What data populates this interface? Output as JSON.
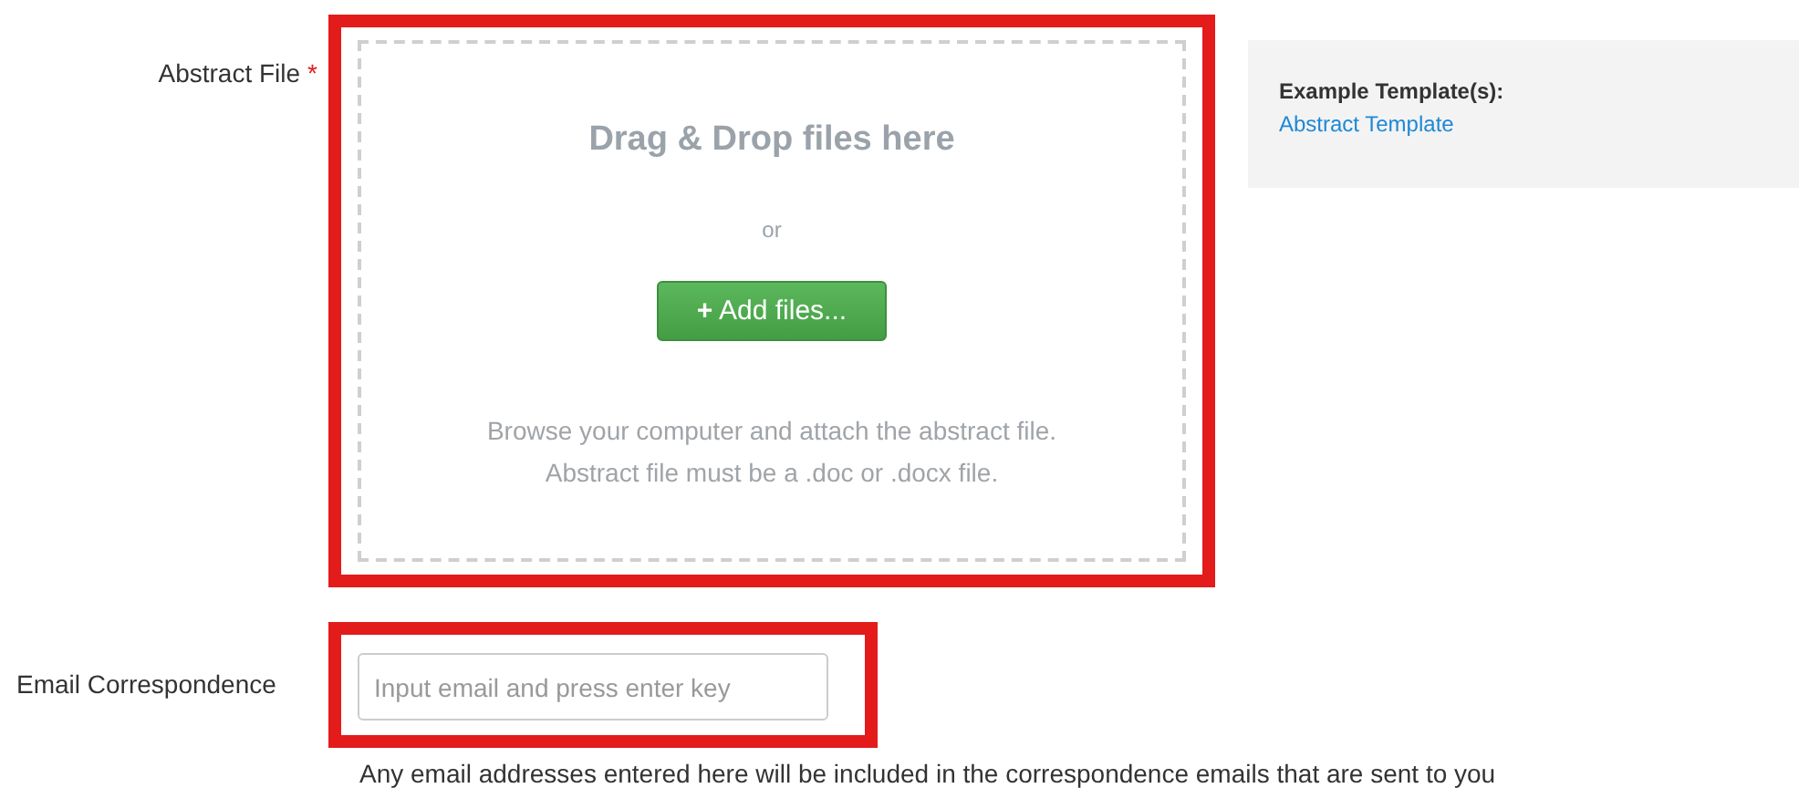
{
  "abstract_file": {
    "label": "Abstract File",
    "required_mark": "*",
    "highlighted": true,
    "dropzone": {
      "title": "Drag & Drop files here",
      "separator": "or",
      "button": {
        "icon": "+",
        "label": "Add files..."
      },
      "hint_lines": [
        "Browse your computer and attach the abstract file.",
        "Abstract file must be a .doc or .docx file."
      ]
    }
  },
  "templates": {
    "heading": "Example Template(s):",
    "links": [
      "Abstract Template"
    ]
  },
  "email": {
    "label": "Email Correspondence",
    "highlighted": true,
    "placeholder": "Input email and press enter key",
    "help": "Any email addresses entered here will be included in the correspondence emails that are sent to you"
  }
}
